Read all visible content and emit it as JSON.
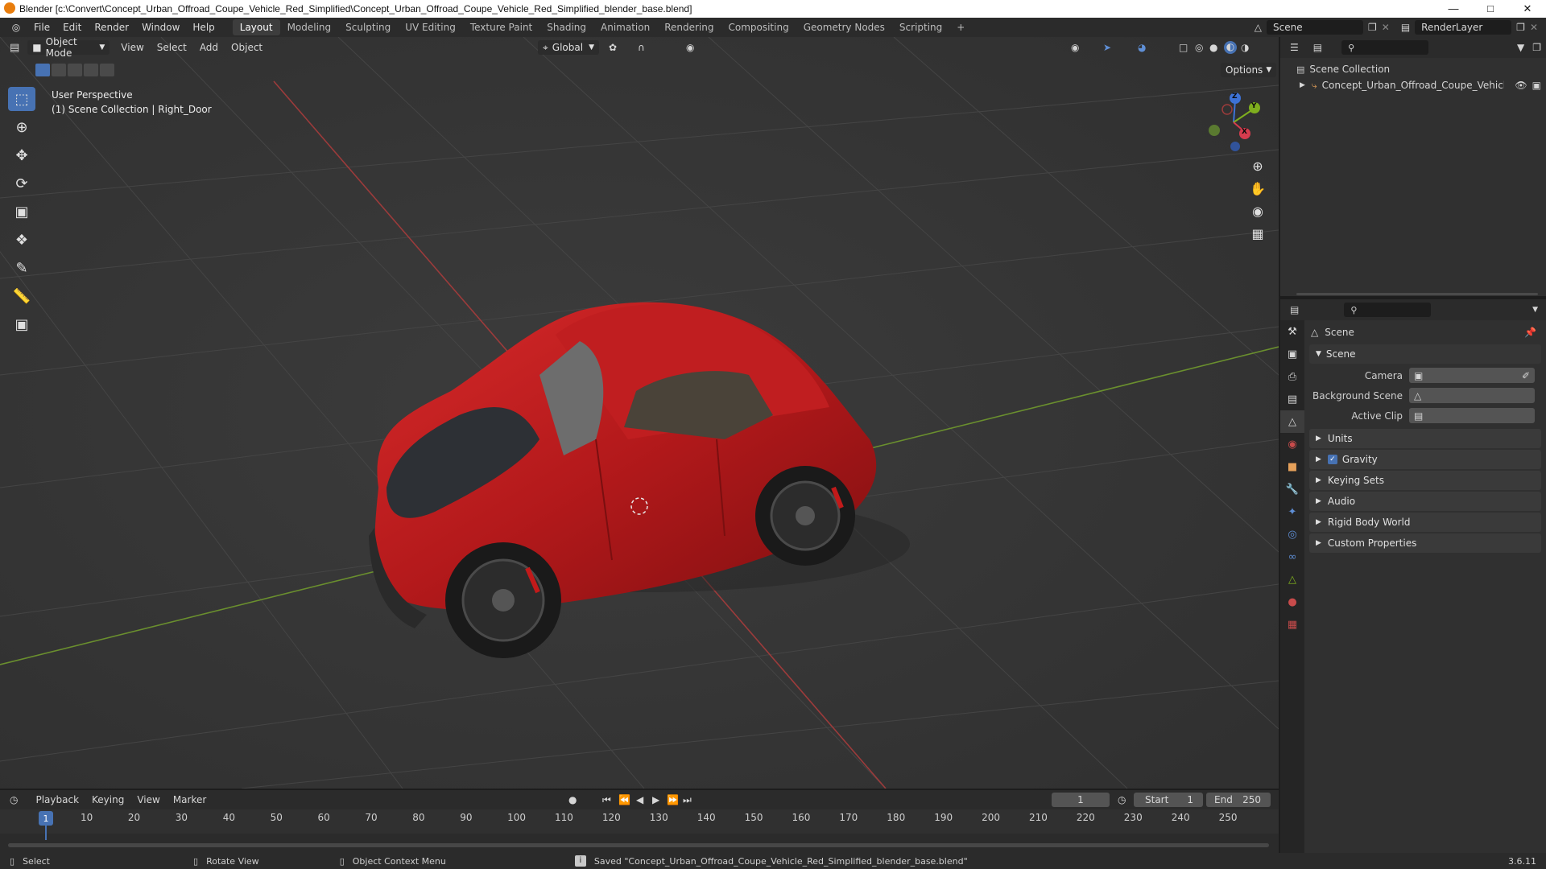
{
  "window": {
    "title": "Blender [c:\\Convert\\Concept_Urban_Offroad_Coupe_Vehicle_Red_Simplified\\Concept_Urban_Offroad_Coupe_Vehicle_Red_Simplified_blender_base.blend]",
    "minimize": "—",
    "maximize": "□",
    "close": "✕"
  },
  "menus": [
    "File",
    "Edit",
    "Render",
    "Window",
    "Help"
  ],
  "workspaces": [
    "Layout",
    "Modeling",
    "Sculpting",
    "UV Editing",
    "Texture Paint",
    "Shading",
    "Animation",
    "Rendering",
    "Compositing",
    "Geometry Nodes",
    "Scripting"
  ],
  "active_workspace": "Layout",
  "add_workspace": "+",
  "scene_name": "Scene",
  "render_layer": "RenderLayer",
  "viewport": {
    "mode": "Object Mode",
    "menus": [
      "View",
      "Select",
      "Add",
      "Object"
    ],
    "orientation": "Global",
    "options_label": "Options",
    "overlay_title": "User Perspective",
    "overlay_subtitle": "(1) Scene Collection | Right_Door",
    "gizmo_axes": {
      "x": "X",
      "y": "Y",
      "z": "Z"
    }
  },
  "outliner": {
    "root": "Scene Collection",
    "items": [
      {
        "label": "Concept_Urban_Offroad_Coupe_Vehicle_"
      }
    ]
  },
  "properties": {
    "header": "Scene",
    "section": "Scene",
    "fields": [
      {
        "label": "Camera",
        "value": ""
      },
      {
        "label": "Background Scene",
        "value": ""
      },
      {
        "label": "Active Clip",
        "value": ""
      }
    ],
    "panels": [
      {
        "label": "Units",
        "checkbox": false
      },
      {
        "label": "Gravity",
        "checkbox": true
      },
      {
        "label": "Keying Sets",
        "checkbox": false
      },
      {
        "label": "Audio",
        "checkbox": false
      },
      {
        "label": "Rigid Body World",
        "checkbox": false
      },
      {
        "label": "Custom Properties",
        "checkbox": false
      }
    ]
  },
  "timeline": {
    "menus": [
      "Playback",
      "Keying",
      "View",
      "Marker"
    ],
    "current_frame": "1",
    "start_label": "Start",
    "start": "1",
    "end_label": "End",
    "end": "250",
    "ruler": [
      "1",
      "10",
      "20",
      "30",
      "40",
      "50",
      "60",
      "70",
      "80",
      "90",
      "100",
      "110",
      "120",
      "130",
      "140",
      "150",
      "160",
      "170",
      "180",
      "190",
      "200",
      "210",
      "220",
      "230",
      "240",
      "250"
    ]
  },
  "statusbar": {
    "select": "Select",
    "rotate": "Rotate View",
    "context": "Object Context Menu",
    "message": "Saved \"Concept_Urban_Offroad_Coupe_Vehicle_Red_Simplified_blender_base.blend\"",
    "version": "3.6.11"
  },
  "colors": {
    "accent": "#4772b3",
    "car_body": "#b3191b",
    "x_axis": "#9c3b3b",
    "y_axis": "#6a8f2e",
    "viewport_bg": "#393939"
  }
}
